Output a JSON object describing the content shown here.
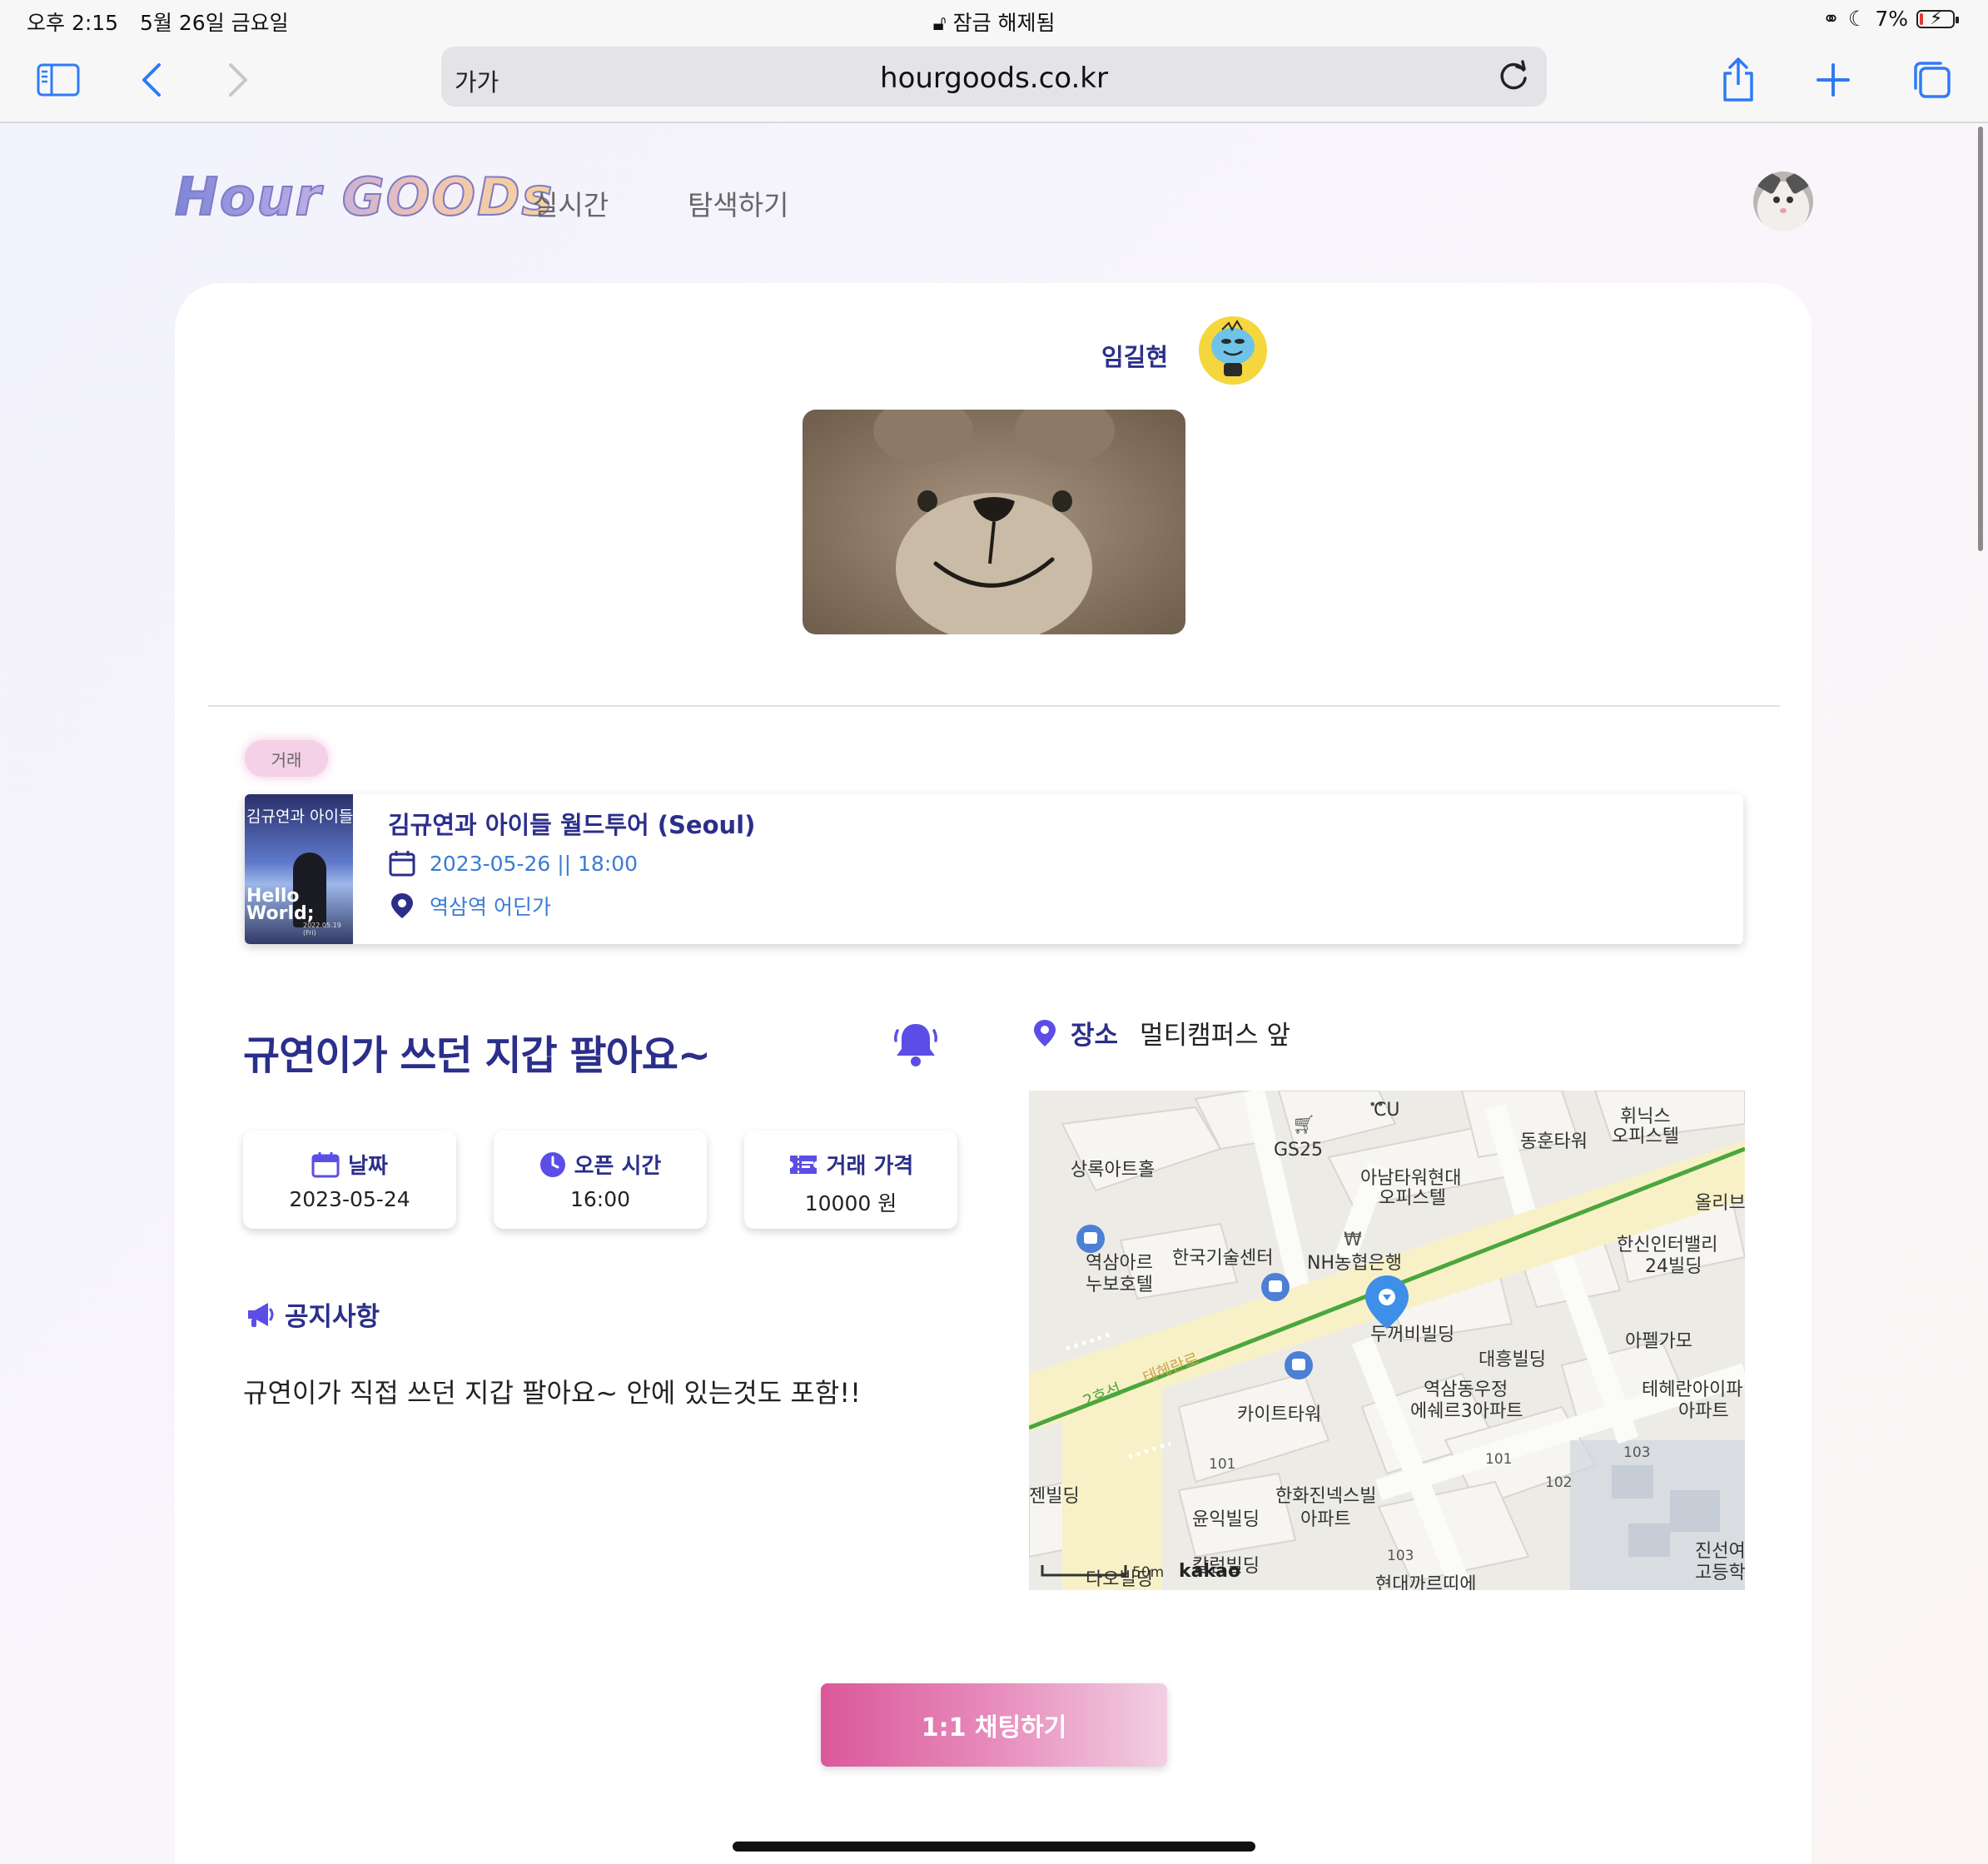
{
  "status_bar": {
    "time": "오후 2:15",
    "date": "5월 26일 금요일",
    "lock_text": "잠금 해제됨",
    "battery": "7%"
  },
  "browser": {
    "text_size": "가가",
    "url": "hourgoods.co.kr"
  },
  "site": {
    "logo": "Hour GOODs",
    "nav": [
      "실시간",
      "탐색하기"
    ]
  },
  "seller": {
    "name": "임길현"
  },
  "trade_tag": "거래",
  "event": {
    "title": "김규연과 아이들 월드투어 (Seoul)",
    "datetime": "2023-05-26 || 18:00",
    "location": "역삼역 어딘가",
    "thumb_title": "김규연과 아이들",
    "thumb_text": "Hello World;",
    "thumb_date": "2022.05.19 (Fri)"
  },
  "post": {
    "title": "규연이가 쓰던 지갑 팔아요~",
    "info": [
      {
        "label": "날짜",
        "value": "2023-05-24",
        "icon": "calendar-icon"
      },
      {
        "label": "오픈 시간",
        "value": "16:00",
        "icon": "clock-icon"
      },
      {
        "label": "거래 가격",
        "value": "10000 원",
        "icon": "ticket-icon"
      }
    ],
    "notice_label": "공지사항",
    "notice_body": "규연이가 직접 쓰던 지갑 팔아요~ 안에 있는것도 포함!!",
    "place_label": "장소",
    "place_value": "멀티캠퍼스 앞"
  },
  "map": {
    "labels": [
      "CU",
      "GS25",
      "휘닉스",
      "오피스텔",
      "동훈타워",
      "상록아트홀",
      "아남타워현대",
      "오피스텔",
      "올리브",
      "한신인터밸리",
      "24빌딩",
      "역삼아르",
      "누보호텔",
      "한국기술센터",
      "NH농협은행",
      "두꺼비빌딩",
      "아펠가모",
      "대흥빌딩",
      "2호선",
      "테헤란로",
      "역삼동우정",
      "에쉐르3아파트",
      "테헤란아이파",
      "아파트",
      "카이트타워",
      "101",
      "103",
      "102",
      "101",
      "젠빌딩",
      "한화진넥스빌",
      "아파트",
      "윤익빌딩",
      "진선여",
      "고등학",
      "103",
      "50m",
      "kakao",
      "현대까르띠에",
      "다오빌딩",
      "칼럼빌딩"
    ]
  },
  "chat_button": "1:1 채팅하기",
  "colors": {
    "accent": "#2b2f8a",
    "link": "#3a7bd5",
    "chat_start": "#db5899",
    "chat_end": "#f2cfe3",
    "bell": "#5b4ee6",
    "map_pin": "#3d8fe8"
  }
}
